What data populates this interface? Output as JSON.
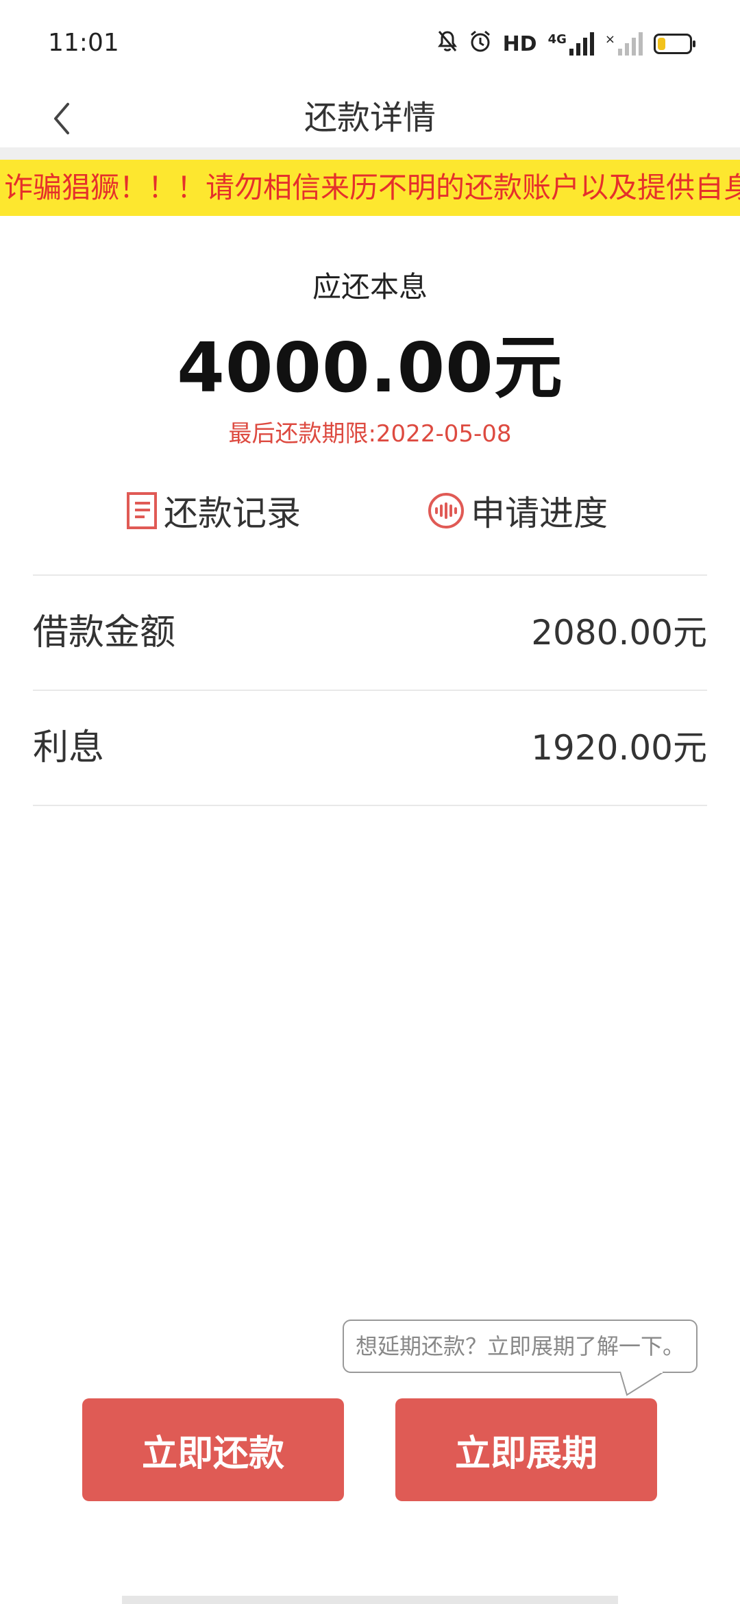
{
  "status_bar": {
    "time": "11:01",
    "icons": [
      "bell-off-icon",
      "alarm-icon",
      "hd-icon",
      "signal-4g-icon",
      "signal-no-sim-icon",
      "battery-icon"
    ],
    "hd_label": "HD",
    "network_label": "4G",
    "battery_level": 0.25,
    "battery_color": "#f2c21b"
  },
  "nav": {
    "title": "还款详情"
  },
  "notice": {
    "text": "诈骗猖獗！！！请勿相信来历不明的还款账户以及提供自身",
    "text_color": "#e5302b",
    "background": "#fde72f"
  },
  "summary": {
    "label": "应还本息",
    "amount": "4000.00元",
    "deadline": "最后还款期限:2022-05-08"
  },
  "quick_links": {
    "records": "还款记录",
    "progress": "申请进度"
  },
  "details": [
    {
      "label": "借款金额",
      "value": "2080.00元"
    },
    {
      "label": "利息",
      "value": "1920.00元"
    }
  ],
  "tooltip": {
    "text": "想延期还款？立即展期了解一下。"
  },
  "buttons": {
    "repay": "立即还款",
    "extend": "立即展期",
    "color": "#df5b55"
  }
}
